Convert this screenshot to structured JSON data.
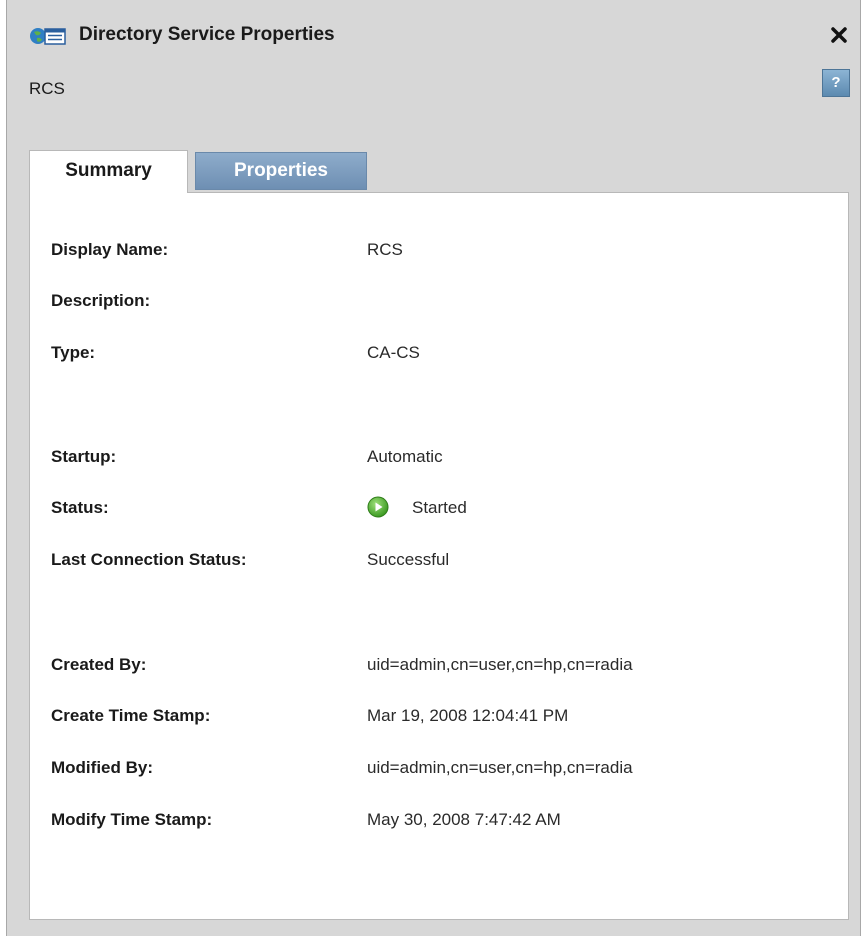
{
  "window": {
    "title": "Directory Service Properties",
    "subtitle": "RCS",
    "help_label": "?",
    "icons": {
      "app": "directory-service-icon",
      "close": "close-icon",
      "status": "started-play-icon"
    },
    "colors": {
      "background": "#d7d7d7",
      "tab_active_bg": "#ffffff",
      "tab_inactive_bg": "#7d9cc0",
      "status_green": "#45a829"
    }
  },
  "tabs": [
    {
      "label": "Summary",
      "active": true
    },
    {
      "label": "Properties",
      "active": false
    }
  ],
  "summary": {
    "display_name": {
      "label": "Display Name:",
      "value": "RCS"
    },
    "description": {
      "label": "Description:",
      "value": ""
    },
    "type": {
      "label": "Type:",
      "value": "CA-CS"
    },
    "startup": {
      "label": "Startup:",
      "value": "Automatic"
    },
    "status": {
      "label": "Status:",
      "value": "Started"
    },
    "last_connection_status": {
      "label": "Last Connection Status:",
      "value": "Successful"
    },
    "created_by": {
      "label": "Created By:",
      "value": "uid=admin,cn=user,cn=hp,cn=radia"
    },
    "create_time_stamp": {
      "label": "Create Time Stamp:",
      "value": "Mar 19, 2008 12:04:41 PM"
    },
    "modified_by": {
      "label": "Modified By:",
      "value": "uid=admin,cn=user,cn=hp,cn=radia"
    },
    "modify_time_stamp": {
      "label": "Modify Time Stamp:",
      "value": "May 30, 2008 7:47:42 AM"
    }
  }
}
